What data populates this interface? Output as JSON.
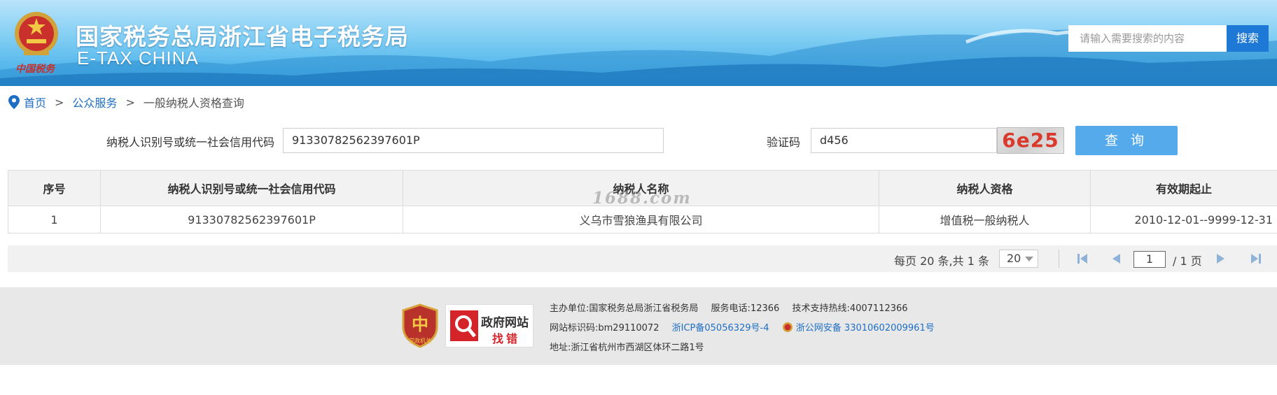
{
  "header": {
    "title": "国家税务总局浙江省电子税务局",
    "subtitle": "E-TAX CHINA",
    "emblem_caption": "中国税务",
    "search_placeholder": "请输入需要搜索的内容",
    "search_button": "搜索"
  },
  "breadcrumb": {
    "home": "首页",
    "separator": ">",
    "level1": "公众服务",
    "current": "一般纳税人资格查询"
  },
  "query_form": {
    "taxpayer_id_label": "纳税人识别号或统一社会信用代码",
    "taxpayer_id_value": "91330782562397601P",
    "captcha_label": "验证码",
    "captcha_value": "d456",
    "captcha_image_text": "6e25",
    "query_button": "查 询"
  },
  "results_table": {
    "columns": [
      "序号",
      "纳税人识别号或统一社会信用代码",
      "纳税人名称",
      "纳税人资格",
      "有效期起止"
    ],
    "rows": [
      [
        "1",
        "91330782562397601P",
        "义乌市雪狼渔具有限公司",
        "增值税一般纳税人",
        "2010-12-01--9999-12-31"
      ]
    ]
  },
  "watermark": "1688.com",
  "pagination": {
    "info": "每页 20 条,共 1 条",
    "page_size": "20",
    "current_page": "1",
    "total_pages": "/ 1 页"
  },
  "footer": {
    "host_label": "主办单位:",
    "host_value": "国家税务总局浙江省税务局",
    "phone_label": "服务电话:",
    "phone_value": "12366",
    "support_label": "技术支持热线:",
    "support_value": "4007112366",
    "site_id_label": "网站标识码:",
    "site_id_value": "bm29110072",
    "icp": "浙ICP备05056329号-4",
    "police": "浙公网安备 33010602009961号",
    "address_label": "地址:",
    "address_value": "浙江省杭州市西湖区体环二路1号",
    "badge_party": "党政机关",
    "badge_gov_line1": "政府网站",
    "badge_gov_line2": "找错"
  },
  "colors": {
    "accent_blue": "#1e79d6",
    "query_button": "#55aaec",
    "link_blue": "#1e6fc4",
    "captcha_red": "#d93a2b"
  }
}
